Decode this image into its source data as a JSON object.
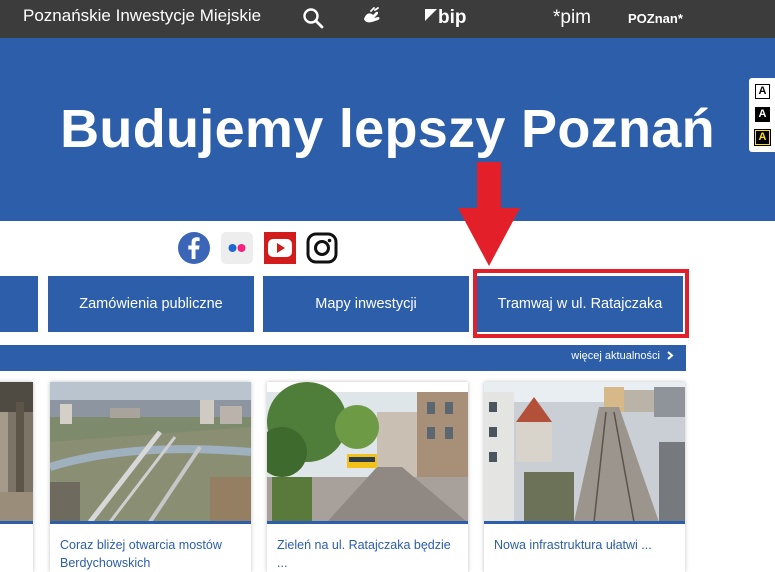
{
  "header": {
    "site_title": "Poznańskie Inwestycje Miejskie",
    "icons": [
      "search-icon",
      "sign-language-icon",
      "bip-logo",
      "pim-logo",
      "poznan-logo"
    ],
    "bip_label": "bip",
    "pim_label": "*pim",
    "poznan_label": "POZnan*"
  },
  "banner": {
    "title": "Budujemy lepszy Poznań"
  },
  "contrast_switcher": [
    "A",
    "A",
    "A"
  ],
  "social": [
    "facebook-icon",
    "flickr-icon",
    "youtube-icon",
    "instagram-icon"
  ],
  "nav_buttons": [
    {
      "label": ""
    },
    {
      "label": "Zamówienia publiczne"
    },
    {
      "label": "Mapy inwestycji"
    },
    {
      "label": "Tramwaj w ul. Ratajczaka"
    }
  ],
  "news": {
    "more_label": "więcej aktualności",
    "items": [
      {
        "title": ""
      },
      {
        "title": "Coraz bliżej otwarcia mostów Berdychowskich"
      },
      {
        "title": "Zieleń na ul. Ratajczaka będzie ..."
      },
      {
        "title": "Nowa infrastruktura ułatwi ..."
      }
    ]
  },
  "colors": {
    "brand_blue": "#2c5ea9",
    "topbar": "#3c3c3c",
    "annotation_red": "#e3202a"
  }
}
